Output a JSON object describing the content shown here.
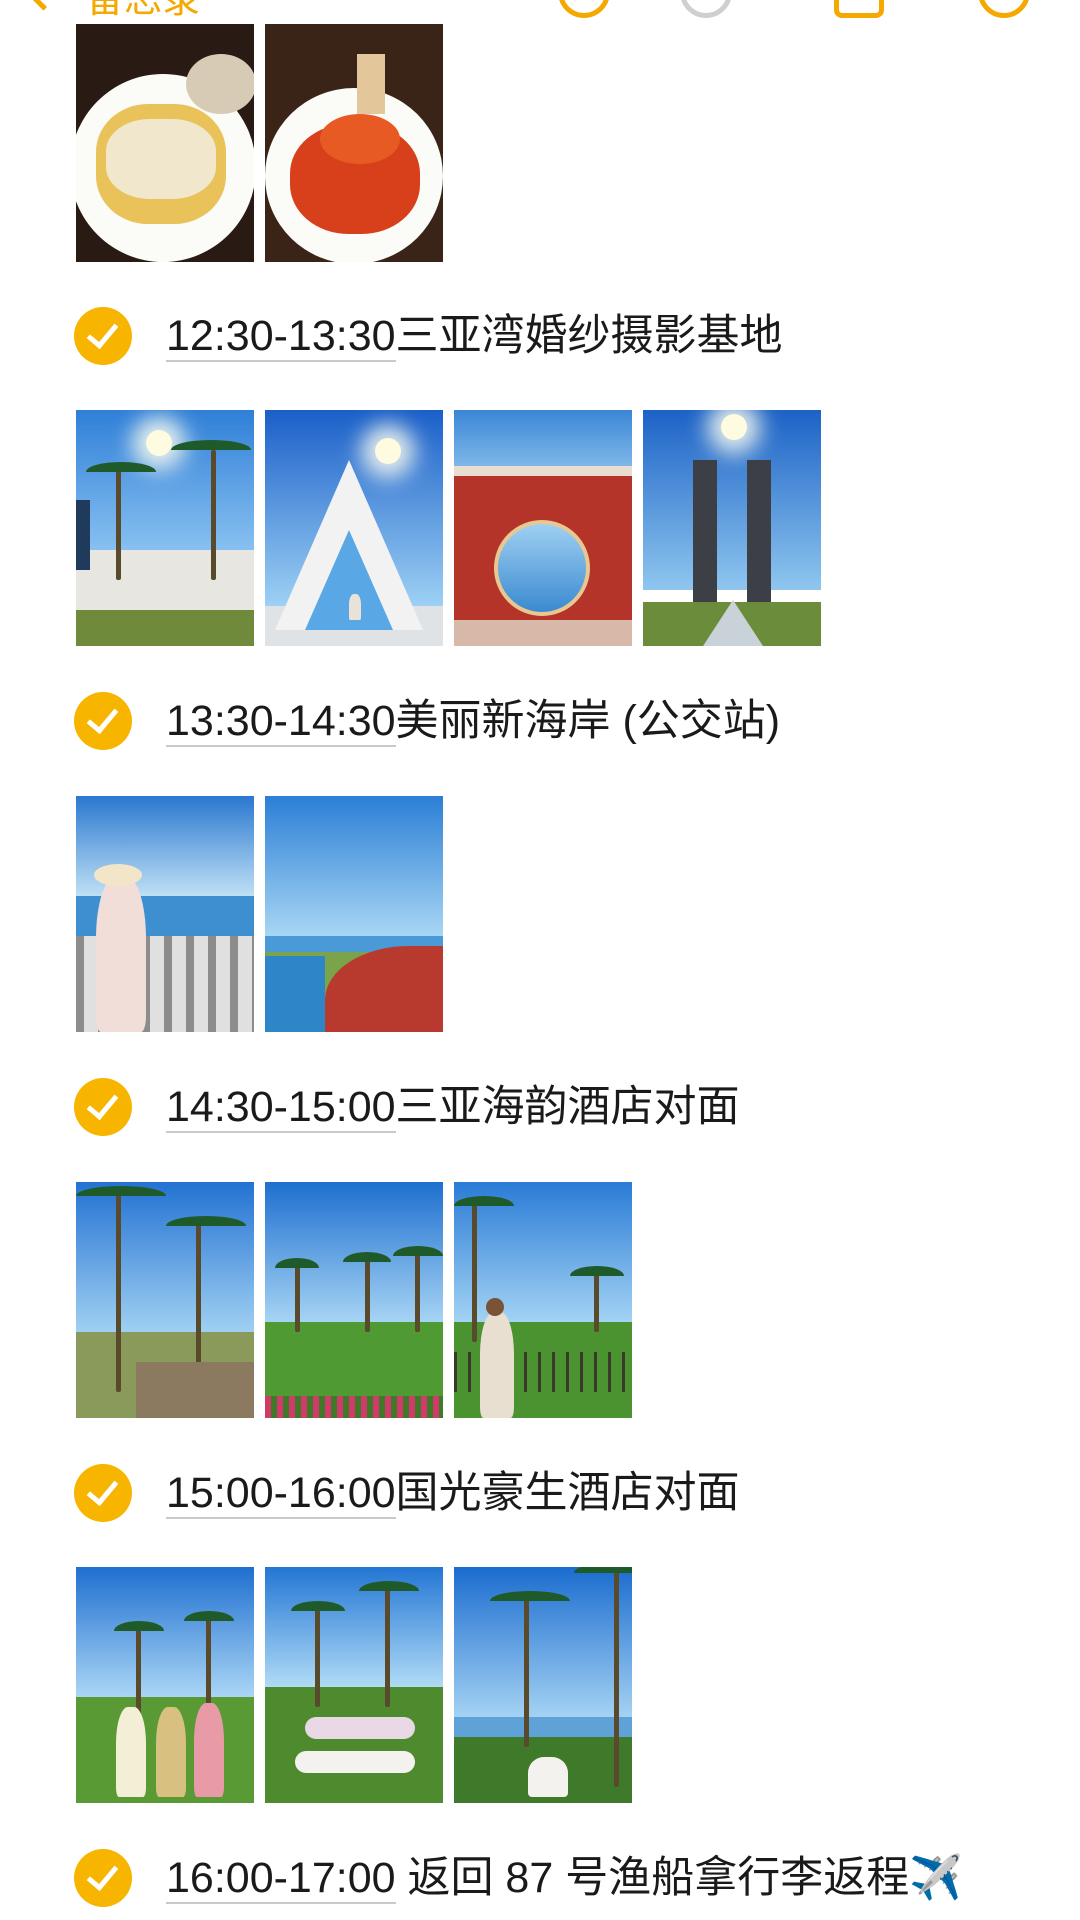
{
  "topbar": {
    "back_label": "备忘录"
  },
  "colors": {
    "accent": "#f5a800",
    "check": "#f7b500",
    "text": "#1a1a1a"
  },
  "icons": [
    "chevron-left-icon",
    "undo-icon",
    "redo-icon",
    "share-icon",
    "more-icon",
    "checkmark-icon",
    "airplane-icon"
  ],
  "items": [
    {
      "time": "12:30-13:30",
      "place": "三亚湾婚纱摄影基地",
      "checked": true
    },
    {
      "time": "13:30-14:30",
      "place": "美丽新海岸 (公交站)",
      "checked": true
    },
    {
      "time": "14:30-15:00",
      "place": "三亚海韵酒店对面",
      "checked": true
    },
    {
      "time": "15:00-16:00",
      "place": "国光豪生酒店对面",
      "checked": true
    },
    {
      "time": "16:00-17:00",
      "place": " 返回 87 号渔船拿行李返程",
      "emoji": "✈️",
      "checked": true
    }
  ],
  "photo_groups": [
    {
      "section": "lunch",
      "count": 2,
      "subjects": [
        "rice-roll-dish",
        "crab-dish"
      ]
    },
    {
      "section": "12:30-13:30",
      "count": 4,
      "subjects": [
        "wedding-lawn-palms",
        "white-arch-sea",
        "red-moon-gate",
        "stone-gate-path"
      ]
    },
    {
      "section": "13:30-14:30",
      "count": 2,
      "subjects": [
        "woman-sea-railing",
        "coastal-red-path"
      ]
    },
    {
      "section": "14:30-15:00",
      "count": 3,
      "subjects": [
        "palm-walkway",
        "lawn-palms-flowers",
        "woman-lawn-palms"
      ]
    },
    {
      "section": "15:00-16:00",
      "count": 3,
      "subjects": [
        "three-women-lawn",
        "women-lying-lawn",
        "woman-sitting-palms"
      ]
    }
  ]
}
